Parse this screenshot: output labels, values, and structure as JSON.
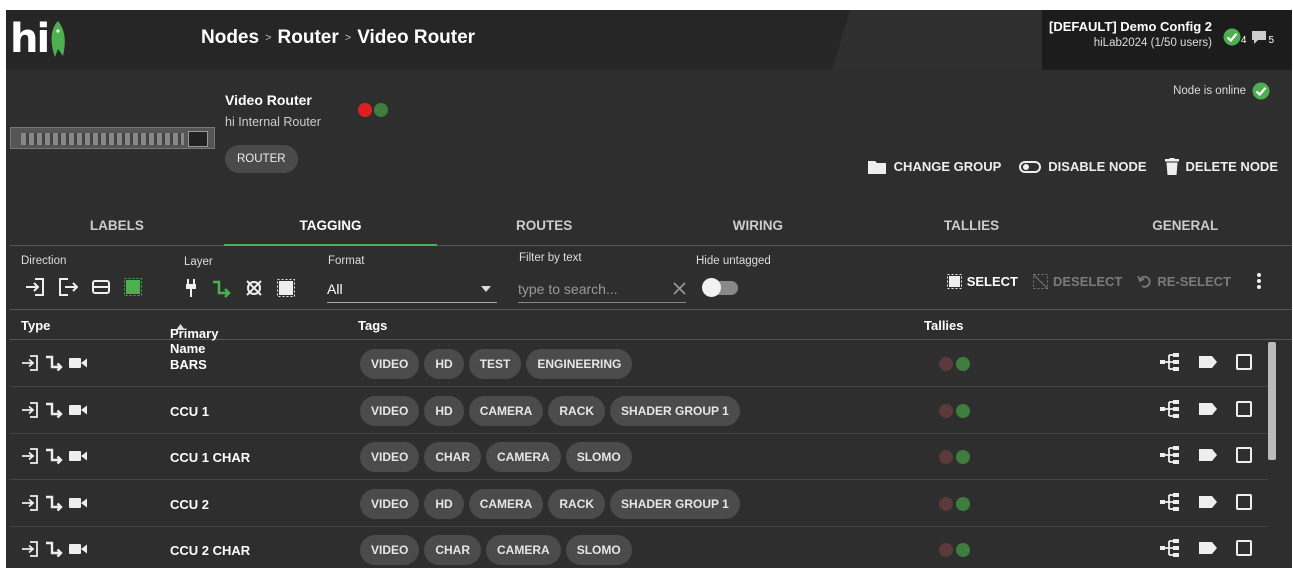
{
  "app": {
    "logo_text": "hi"
  },
  "breadcrumb": {
    "items": [
      "Nodes",
      "Router",
      "Video Router"
    ],
    "separator": ">"
  },
  "config": {
    "title": "[DEFAULT] Demo Config 2",
    "subtitle": "hiLab2024 (1/50 users)"
  },
  "status": {
    "checks_count": "4",
    "messages_count": "5"
  },
  "node": {
    "title": "Video Router",
    "subtitle": "hi Internal Router",
    "chip": "ROUTER",
    "online_text": "Node is online",
    "status_colors": [
      "#e02020",
      "#3f7d3f"
    ]
  },
  "actions": {
    "change_group": "CHANGE GROUP",
    "disable_node": "DISABLE NODE",
    "delete_node": "DELETE NODE"
  },
  "tabs": [
    "LABELS",
    "TAGGING",
    "ROUTES",
    "WIRING",
    "TALLIES",
    "GENERAL"
  ],
  "active_tab": "TAGGING",
  "filters": {
    "direction_label": "Direction",
    "layer_label": "Layer",
    "format_label": "Format",
    "format_value": "All",
    "filter_label": "Filter by text",
    "filter_placeholder": "type to search...",
    "hide_label": "Hide untagged"
  },
  "selection": {
    "select": "SELECT",
    "deselect": "DESELECT",
    "reselect": "RE-SELECT"
  },
  "table": {
    "headers": {
      "type": "Type",
      "name": "Primary Name",
      "tags": "Tags",
      "tallies": "Tallies"
    },
    "rows": [
      {
        "name": "BARS",
        "tags": [
          "VIDEO",
          "HD",
          "TEST",
          "ENGINEERING"
        ]
      },
      {
        "name": "CCU 1",
        "tags": [
          "VIDEO",
          "HD",
          "CAMERA",
          "RACK",
          "SHADER GROUP 1"
        ]
      },
      {
        "name": "CCU 1 CHAR",
        "tags": [
          "VIDEO",
          "CHAR",
          "CAMERA",
          "SLOMO"
        ]
      },
      {
        "name": "CCU 2",
        "tags": [
          "VIDEO",
          "HD",
          "CAMERA",
          "RACK",
          "SHADER GROUP 1"
        ]
      },
      {
        "name": "CCU 2 CHAR",
        "tags": [
          "VIDEO",
          "CHAR",
          "CAMERA",
          "SLOMO"
        ]
      }
    ],
    "tally_colors": [
      "#5a3a3a",
      "#3f7d3f"
    ]
  },
  "colors": {
    "accent": "#4caf50",
    "background": "#2e2e2e"
  }
}
